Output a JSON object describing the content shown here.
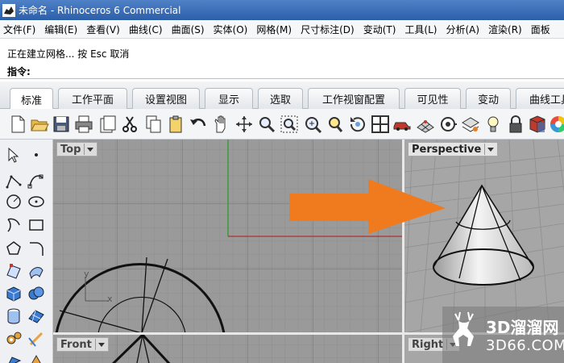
{
  "window": {
    "title": "未命名 - Rhinoceros 6 Commercial"
  },
  "menubar": {
    "items": [
      "文件(F)",
      "编辑(E)",
      "查看(V)",
      "曲线(C)",
      "曲面(S)",
      "实体(O)",
      "网格(M)",
      "尺寸标注(D)",
      "变动(T)",
      "工具(L)",
      "分析(A)",
      "渲染(R)",
      "面板"
    ]
  },
  "command": {
    "history": "正在建立网格... 按 Esc 取消",
    "prompt": "指令:"
  },
  "tabs": [
    "标准",
    "工作平面",
    "设置视图",
    "显示",
    "选取",
    "工作视窗配置",
    "可见性",
    "变动",
    "曲线工具"
  ],
  "active_tab": "标准",
  "toolbar": {
    "icons": [
      "new-icon",
      "open-icon",
      "save-icon",
      "print-icon",
      "import-icon",
      "cut-icon",
      "copy-icon",
      "paste-icon",
      "undo-icon",
      "pan-icon",
      "rotate-view-icon",
      "zoom-icon",
      "zoom-window-icon",
      "zoom-extents-icon",
      "zoom-selected-icon",
      "rotate-icon",
      "four-viewports-icon",
      "car-icon",
      "mesh-icon",
      "target-icon",
      "layer-icon",
      "light-icon",
      "lock-icon",
      "material-icon",
      "color-wheel-icon"
    ]
  },
  "viewports": {
    "top": "Top",
    "perspective": "Perspective",
    "front": "Front",
    "right": "Right"
  },
  "axes": {
    "x": "x",
    "y": "y"
  },
  "watermark": {
    "name": "3D溜溜网",
    "url": "3D66.COM"
  },
  "colors": {
    "titlebar": "#3a6db5",
    "arrow": "#f07a1e",
    "viewport_bg": "#9a9a9a",
    "x_axis": "#b03030",
    "y_axis": "#2f9a2f"
  }
}
